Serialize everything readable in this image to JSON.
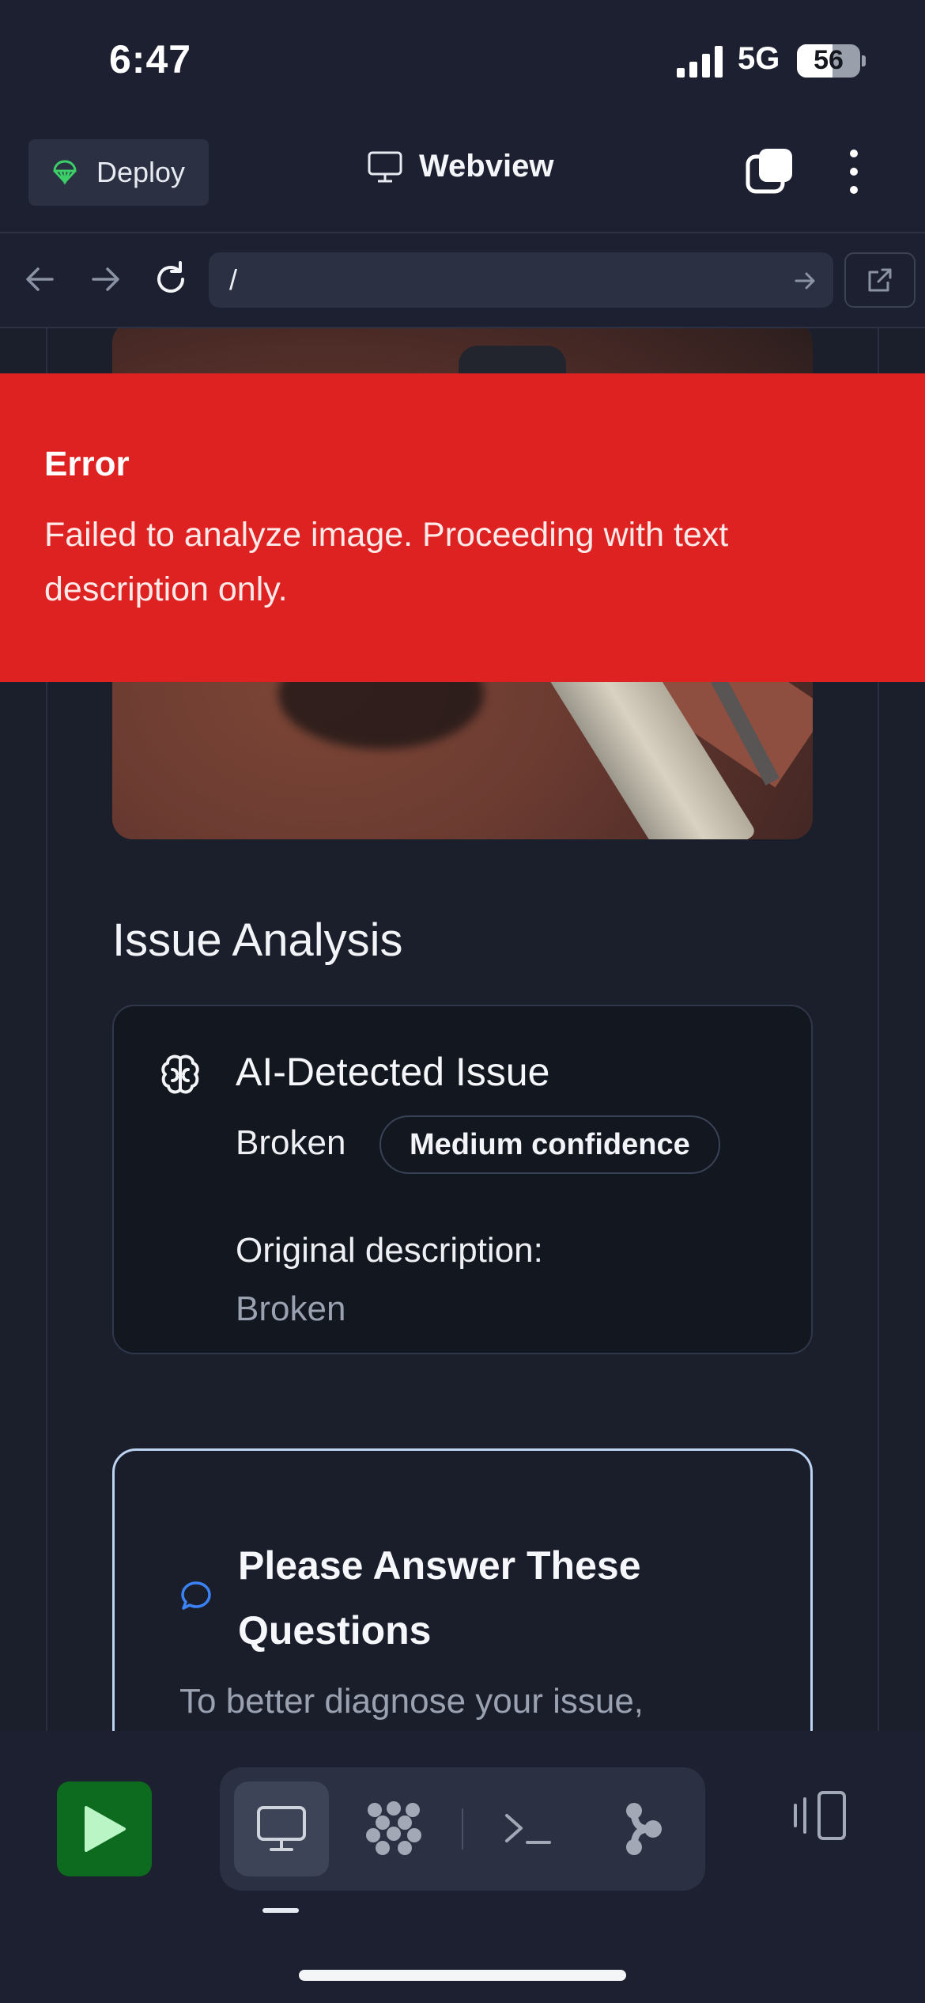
{
  "status_bar": {
    "time": "6:47",
    "network": "5G",
    "battery": "56"
  },
  "topbar": {
    "deploy_label": "Deploy",
    "title": "Webview"
  },
  "urlbar": {
    "url": "/"
  },
  "error": {
    "title": "Error",
    "message": "Failed to analyze image. Proceeding with text description only."
  },
  "analysis": {
    "section_title": "Issue Analysis",
    "card_title": "AI-Detected Issue",
    "issue_label": "Broken",
    "confidence": "Medium confidence",
    "original_label": "Original description:",
    "original_value": "Broken"
  },
  "questions": {
    "title": "Please Answer These Questions",
    "body": "To better diagnose your issue,"
  },
  "colors": {
    "accent_green": "#0d6b1f",
    "error_red": "#de2222",
    "highlight_blue": "#bcd3f2"
  }
}
